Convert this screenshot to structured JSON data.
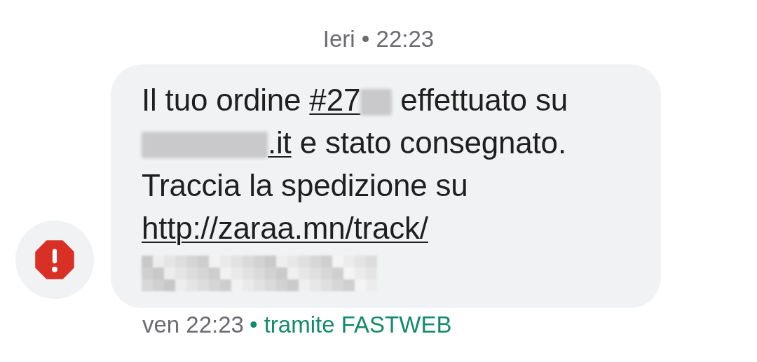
{
  "header": {
    "text": "Ieri • 22:23"
  },
  "message": {
    "failed": true,
    "lines": [
      [
        {
          "kind": "text",
          "text": "Il tuo ordine "
        },
        {
          "kind": "link",
          "text": "#27"
        },
        {
          "kind": "redacted-short"
        },
        {
          "kind": "text",
          "text": " effettuato su"
        }
      ],
      [
        {
          "kind": "redacted-medium"
        },
        {
          "kind": "link",
          "text": ".it"
        },
        {
          "kind": "text",
          "text": " e stato consegnato."
        }
      ],
      [
        {
          "kind": "text",
          "text": "Traccia la spedizione su"
        }
      ],
      [
        {
          "kind": "link",
          "text": "http://zaraa.mn/track/"
        }
      ],
      [
        {
          "kind": "pixelated"
        }
      ]
    ]
  },
  "footer": {
    "time": "ven 22:23",
    "via": "• tramite FASTWEB"
  }
}
